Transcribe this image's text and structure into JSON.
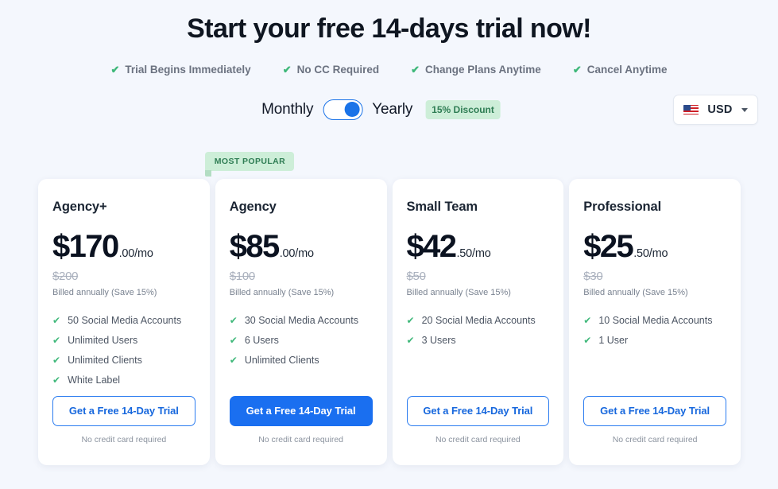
{
  "header": {
    "title": "Start your free 14-days trial now!",
    "perks": [
      "Trial Begins Immediately",
      "No CC Required",
      "Change Plans Anytime",
      "Cancel Anytime"
    ],
    "check_icon": "✔"
  },
  "billing": {
    "monthly_label": "Monthly",
    "yearly_label": "Yearly",
    "selected": "Yearly",
    "discount_badge": "15% Discount",
    "toggle_on": true
  },
  "currency": {
    "code": "USD",
    "flag_icon": "us-flag-icon",
    "caret_icon": "chevron-down-icon"
  },
  "popular_badge": "MOST POPULAR",
  "colors": {
    "page_bg": "#f4f7fd",
    "accent_blue": "#1a6ff0",
    "accent_green": "#3fb87a",
    "badge_green_bg": "#cdeed8",
    "badge_green_text": "#2f7d54",
    "muted_text": "#7a8391"
  },
  "plans": [
    {
      "name": "Agency+",
      "price_main": "$170",
      "price_cents": ".00/mo",
      "old_price": "$200",
      "billed": "Billed annually (Save 15%)",
      "features": [
        "50 Social Media Accounts",
        "Unlimited Users",
        "Unlimited Clients",
        "White Label"
      ],
      "cta": "Get a Free 14-Day Trial",
      "cta_style": "outline",
      "note": "No credit card required",
      "most_popular": false
    },
    {
      "name": "Agency",
      "price_main": "$85",
      "price_cents": ".00/mo",
      "old_price": "$100",
      "billed": "Billed annually (Save 15%)",
      "features": [
        "30 Social Media Accounts",
        "6 Users",
        "Unlimited Clients"
      ],
      "cta": "Get a Free 14-Day Trial",
      "cta_style": "filled",
      "note": "No credit card required",
      "most_popular": true
    },
    {
      "name": "Small Team",
      "price_main": "$42",
      "price_cents": ".50/mo",
      "old_price": "$50",
      "billed": "Billed annually (Save 15%)",
      "features": [
        "20 Social Media Accounts",
        "3 Users"
      ],
      "cta": "Get a Free 14-Day Trial",
      "cta_style": "outline",
      "note": "No credit card required",
      "most_popular": false
    },
    {
      "name": "Professional",
      "price_main": "$25",
      "price_cents": ".50/mo",
      "old_price": "$30",
      "billed": "Billed annually (Save 15%)",
      "features": [
        "10 Social Media Accounts",
        "1 User"
      ],
      "cta": "Get a Free 14-Day Trial",
      "cta_style": "outline",
      "note": "No credit card required",
      "most_popular": false
    }
  ]
}
